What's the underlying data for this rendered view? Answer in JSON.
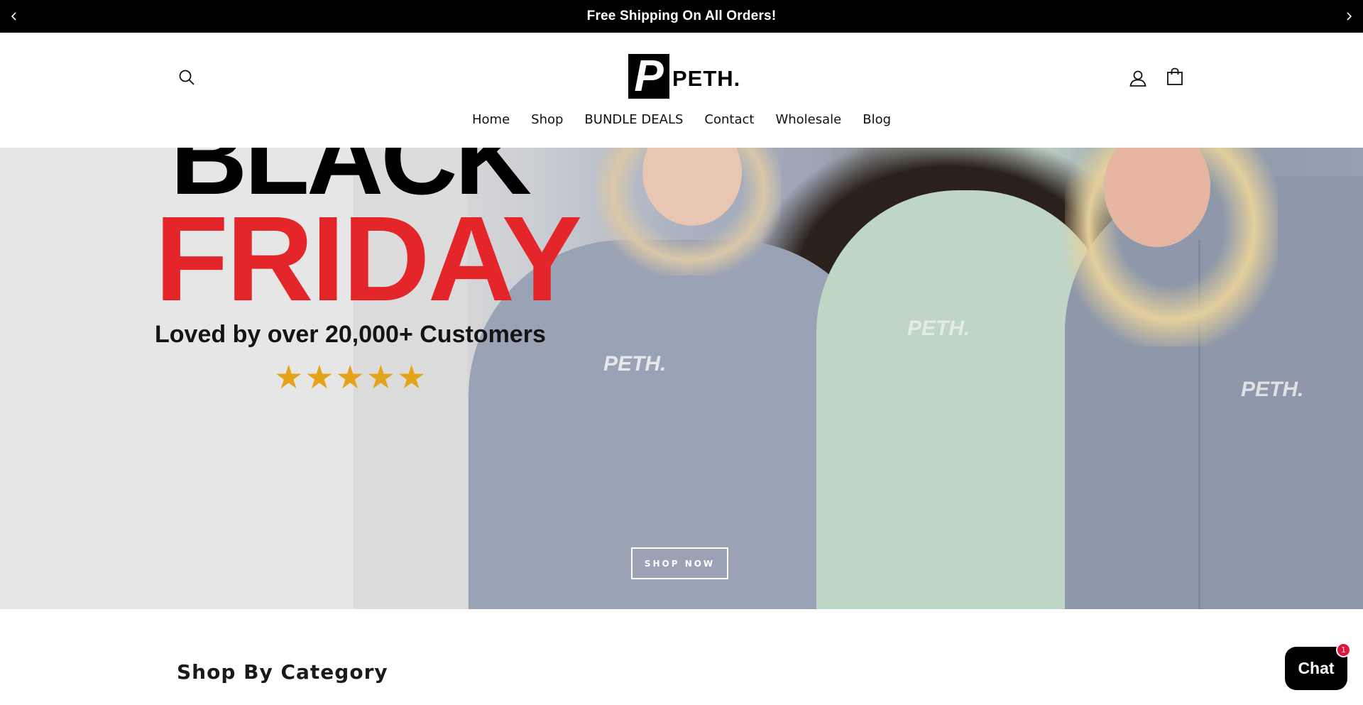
{
  "announcement": {
    "text": "Free Shipping On All Orders!",
    "prev_icon": "chevron-left-icon",
    "next_icon": "chevron-right-icon"
  },
  "header": {
    "logo_mark": "P",
    "logo_word": "PETH.",
    "search_icon": "search-icon",
    "account_icon": "user-icon",
    "cart_icon": "shopping-bag-icon"
  },
  "nav": {
    "items": [
      {
        "label": "Home"
      },
      {
        "label": "Shop"
      },
      {
        "label": "BUNDLE DEALS"
      },
      {
        "label": "Contact"
      },
      {
        "label": "Wholesale"
      },
      {
        "label": "Blog"
      }
    ]
  },
  "hero": {
    "headline_top": "BLACK",
    "headline_main": "FRIDAY",
    "subheadline": "Loved by over 20,000+ Customers",
    "stars": "★★★★★",
    "chest_logo": "PETH.",
    "button_label": "SHOP NOW",
    "colors": {
      "friday_red": "#e4262a",
      "star_gold": "#e3a41a"
    }
  },
  "category_section": {
    "heading": "Shop By Category"
  },
  "chat": {
    "label": "Chat",
    "badge_count": "1"
  }
}
